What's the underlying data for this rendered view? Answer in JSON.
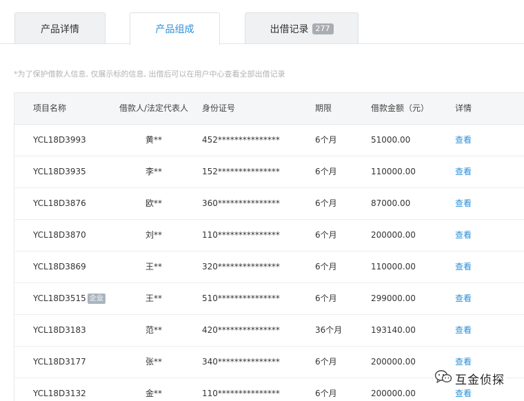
{
  "tabs": [
    {
      "label": "产品详情",
      "active": false
    },
    {
      "label": "产品组成",
      "active": true
    },
    {
      "label": "出借记录",
      "badge": "277",
      "active": false
    }
  ],
  "notice": "*为了保护借款人信息, 仅展示标的信息, 出借后可以在用户中心查看全部出借记录",
  "table": {
    "headers": {
      "name": "项目名称",
      "person": "借款人/法定代表人",
      "id": "身份证号",
      "term": "期限",
      "amount": "借款金额（元）",
      "detail": "详情"
    },
    "corp_label": "企业",
    "rows": [
      {
        "name": "YCL18D3993",
        "person": "黄**",
        "id": "452***************",
        "term": "6个月",
        "amount": "51000.00",
        "detail": "查看"
      },
      {
        "name": "YCL18D3935",
        "person": "李**",
        "id": "152***************",
        "term": "6个月",
        "amount": "110000.00",
        "detail": "查看"
      },
      {
        "name": "YCL18D3876",
        "person": "欧**",
        "id": "360***************",
        "term": "6个月",
        "amount": "87000.00",
        "detail": "查看"
      },
      {
        "name": "YCL18D3870",
        "person": "刘**",
        "id": "110***************",
        "term": "6个月",
        "amount": "200000.00",
        "detail": "查看"
      },
      {
        "name": "YCL18D3869",
        "person": "王**",
        "id": "320***************",
        "term": "6个月",
        "amount": "110000.00",
        "detail": "查看"
      },
      {
        "name": "YCL18D3515",
        "corp": true,
        "person": "王**",
        "id": "510***************",
        "term": "6个月",
        "amount": "299000.00",
        "detail": "查看"
      },
      {
        "name": "YCL18D3183",
        "person": "范**",
        "id": "420***************",
        "term": "36个月",
        "amount": "193140.00",
        "detail": "查看"
      },
      {
        "name": "YCL18D3177",
        "person": "张**",
        "id": "340***************",
        "term": "6个月",
        "amount": "200000.00",
        "detail": "查看"
      },
      {
        "name": "YCL18D3132",
        "person": "金**",
        "id": "110***************",
        "term": "6个月",
        "amount": "200000.00",
        "detail": "查看"
      }
    ]
  },
  "watermark": {
    "icon": "wechat-icon",
    "text": "互金侦探"
  },
  "colors": {
    "accent": "#2b8fd8",
    "badge": "#a9adb2",
    "header_bg": "#f5f6f7"
  }
}
